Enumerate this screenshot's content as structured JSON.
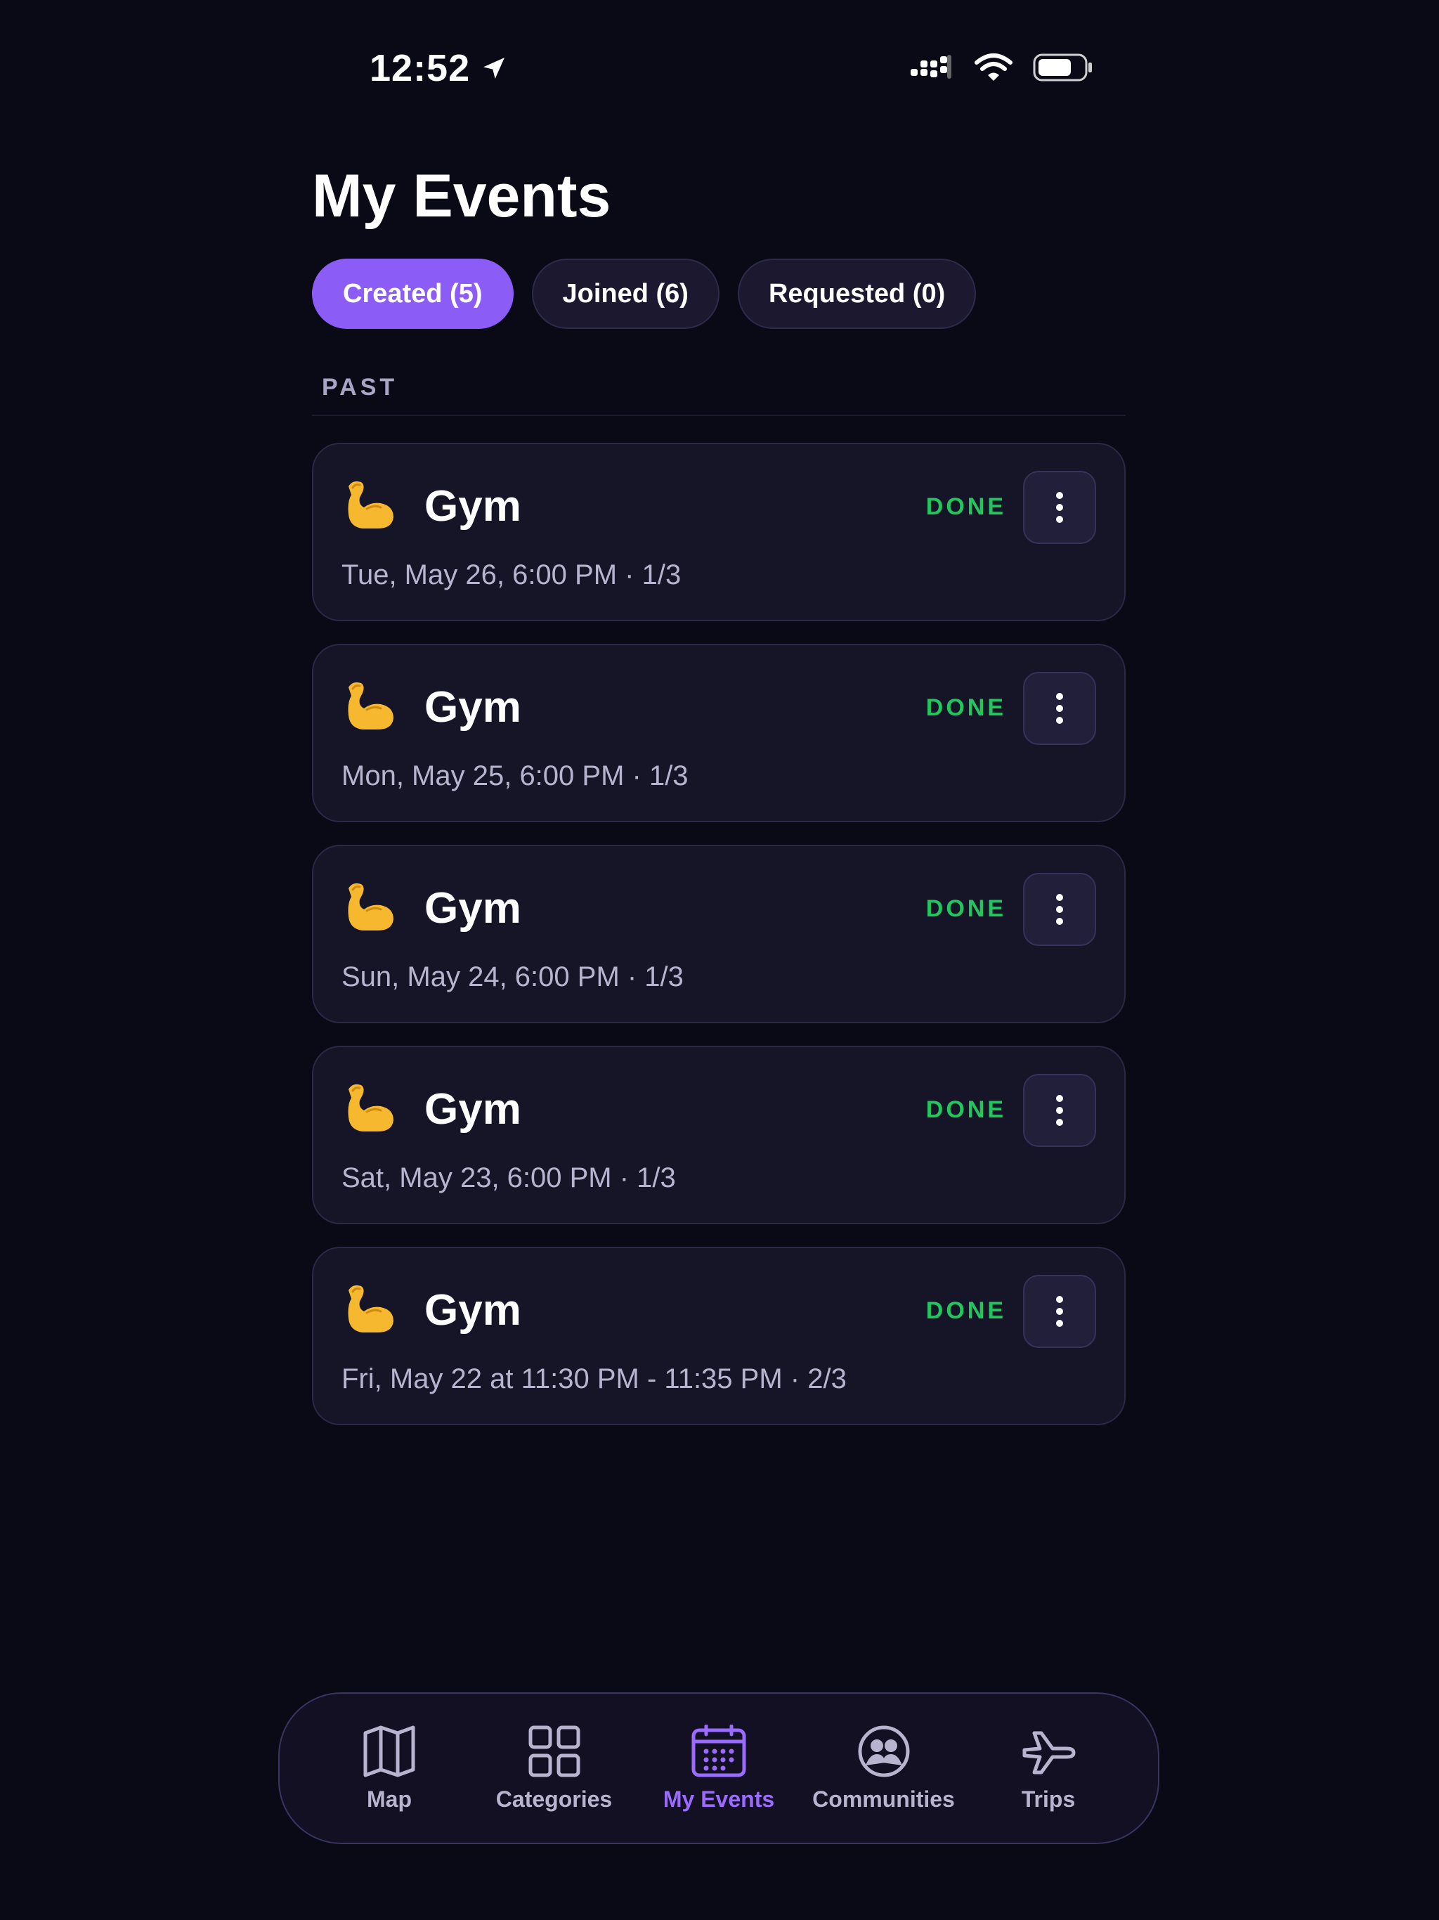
{
  "status_bar": {
    "time": "12:52",
    "icons": [
      "location-arrow-icon",
      "cellular-signal-icon",
      "wifi-icon",
      "battery-icon"
    ]
  },
  "header": {
    "title": "My Events"
  },
  "tabs": [
    {
      "label": "Created (5)",
      "active": true
    },
    {
      "label": "Joined (6)",
      "active": false
    },
    {
      "label": "Requested (0)",
      "active": false
    }
  ],
  "section": {
    "label": "PAST"
  },
  "events": [
    {
      "icon": "flexed-biceps-emoji",
      "title": "Gym",
      "subtitle": "Tue, May 26, 6:00 PM · 1/3",
      "status": "DONE"
    },
    {
      "icon": "flexed-biceps-emoji",
      "title": "Gym",
      "subtitle": "Mon, May 25, 6:00 PM · 1/3",
      "status": "DONE"
    },
    {
      "icon": "flexed-biceps-emoji",
      "title": "Gym",
      "subtitle": "Sun, May 24, 6:00 PM · 1/3",
      "status": "DONE"
    },
    {
      "icon": "flexed-biceps-emoji",
      "title": "Gym",
      "subtitle": "Sat, May 23, 6:00 PM · 1/3",
      "status": "DONE"
    },
    {
      "icon": "flexed-biceps-emoji",
      "title": "Gym",
      "subtitle": "Fri, May 22 at 11:30 PM - 11:35 PM · 2/3",
      "status": "DONE"
    }
  ],
  "nav": [
    {
      "label": "Map",
      "icon": "map-icon",
      "active": false
    },
    {
      "label": "Categories",
      "icon": "grid-icon",
      "active": false
    },
    {
      "label": "My Events",
      "icon": "calendar-icon",
      "active": true
    },
    {
      "label": "Communities",
      "icon": "people-icon",
      "active": false
    },
    {
      "label": "Trips",
      "icon": "airplane-icon",
      "active": false
    }
  ],
  "colors": {
    "background": "#0a0916",
    "card": "#161427",
    "accent": "#8b5cf6",
    "done": "#22c55e",
    "muted_text": "#b8b4cf"
  }
}
